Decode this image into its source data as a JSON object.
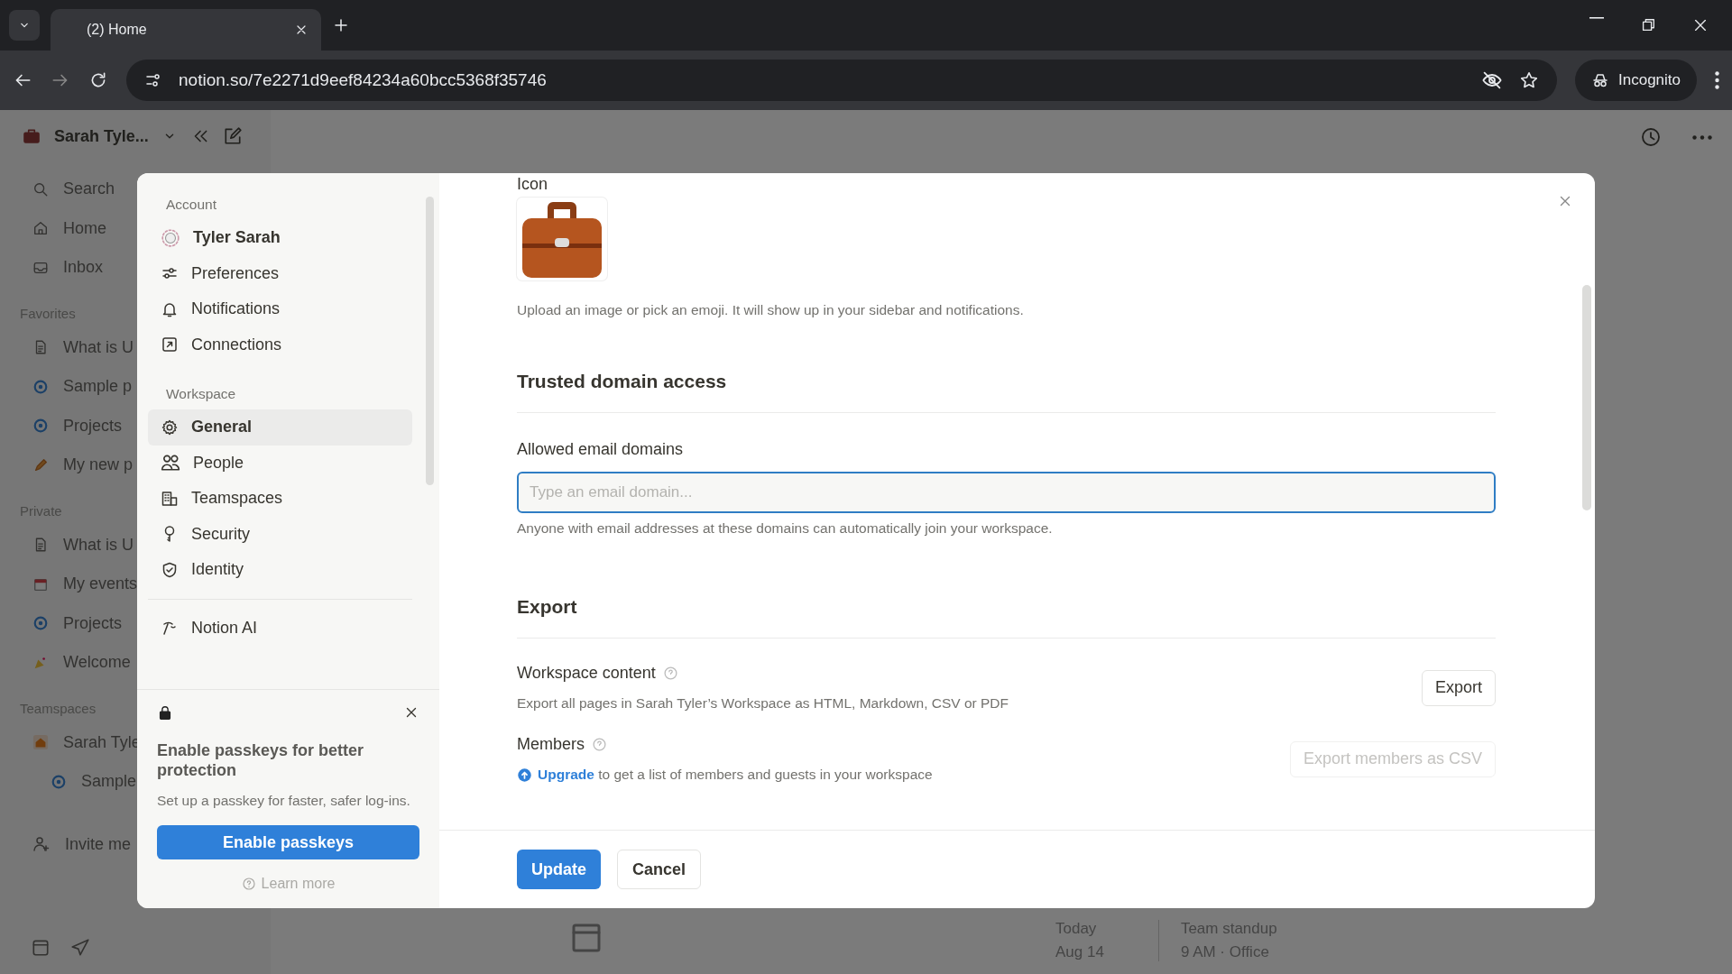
{
  "browser": {
    "tab_title": "(2) Home",
    "url": "notion.so/7e2271d9eef84234a60bcc5368f35746",
    "profile": "Incognito"
  },
  "sidebar": {
    "workspace": "Sarah Tyle...",
    "nav": [
      {
        "label": "Search",
        "kind": "search"
      },
      {
        "label": "Home",
        "kind": "home"
      },
      {
        "label": "Inbox",
        "kind": "inbox"
      }
    ],
    "sections": [
      {
        "title": "Favorites",
        "items": [
          {
            "label": "What is U",
            "kind": "page"
          },
          {
            "label": "Sample p",
            "kind": "project"
          },
          {
            "label": "Projects",
            "kind": "project"
          },
          {
            "label": "My new p",
            "kind": "pencil"
          }
        ]
      },
      {
        "title": "Private",
        "items": [
          {
            "label": "What is U",
            "kind": "page"
          },
          {
            "label": "My events",
            "kind": "calendar"
          },
          {
            "label": "Projects",
            "kind": "project"
          },
          {
            "label": "Welcome",
            "kind": "emoji"
          }
        ]
      },
      {
        "title": "Teamspaces",
        "items": [
          {
            "label": "Sarah Tyle",
            "kind": "team",
            "children": [
              {
                "label": "Sample",
                "kind": "project"
              }
            ]
          }
        ]
      }
    ],
    "invite": "Invite me"
  },
  "background_page": {
    "date_label": "Today",
    "date": "Aug 14",
    "event": "Team standup",
    "event_detail": "9 AM · Office"
  },
  "settings": {
    "nav_sections": [
      {
        "title": "Account",
        "items": [
          {
            "label": "Tyler Sarah",
            "kind": "avatar",
            "selected": false
          },
          {
            "label": "Preferences",
            "kind": "sliders",
            "selected": false
          },
          {
            "label": "Notifications",
            "kind": "bell",
            "selected": false
          },
          {
            "label": "Connections",
            "kind": "link",
            "selected": false
          }
        ]
      },
      {
        "title": "Workspace",
        "items": [
          {
            "label": "General",
            "kind": "gear",
            "selected": true
          },
          {
            "label": "People",
            "kind": "people",
            "selected": false
          },
          {
            "label": "Teamspaces",
            "kind": "building",
            "selected": false
          },
          {
            "label": "Security",
            "kind": "key",
            "selected": false
          },
          {
            "label": "Identity",
            "kind": "shield",
            "selected": false
          }
        ]
      }
    ],
    "extra_items": [
      {
        "label": "Notion AI",
        "kind": "ai",
        "selected": false
      }
    ],
    "passkey_banner": {
      "title": "Enable passkeys for better protection",
      "description": "Set up a passkey for faster, safer log-ins.",
      "button": "Enable passkeys",
      "link": "Learn more"
    },
    "icon_label": "Icon",
    "icon_hint": "Upload an image or pick an emoji. It will show up in your sidebar and notifications.",
    "trusted": {
      "heading": "Trusted domain access",
      "field_label": "Allowed email domains",
      "placeholder": "Type an email domain...",
      "hint": "Anyone with email addresses at these domains can automatically join your workspace."
    },
    "export": {
      "heading": "Export",
      "rows": [
        {
          "title": "Workspace content",
          "description": "Export all pages in Sarah Tyler’s Workspace as HTML, Markdown, CSV or PDF",
          "button": "Export",
          "disabled": false
        },
        {
          "title": "Members",
          "link": "Upgrade",
          "description": "to get a list of members and guests in your workspace",
          "button": "Export members as CSV",
          "disabled": true
        }
      ]
    },
    "footer_buttons": [
      {
        "label": "Update",
        "kind": "primary"
      },
      {
        "label": "Cancel",
        "kind": "secondary"
      }
    ]
  }
}
